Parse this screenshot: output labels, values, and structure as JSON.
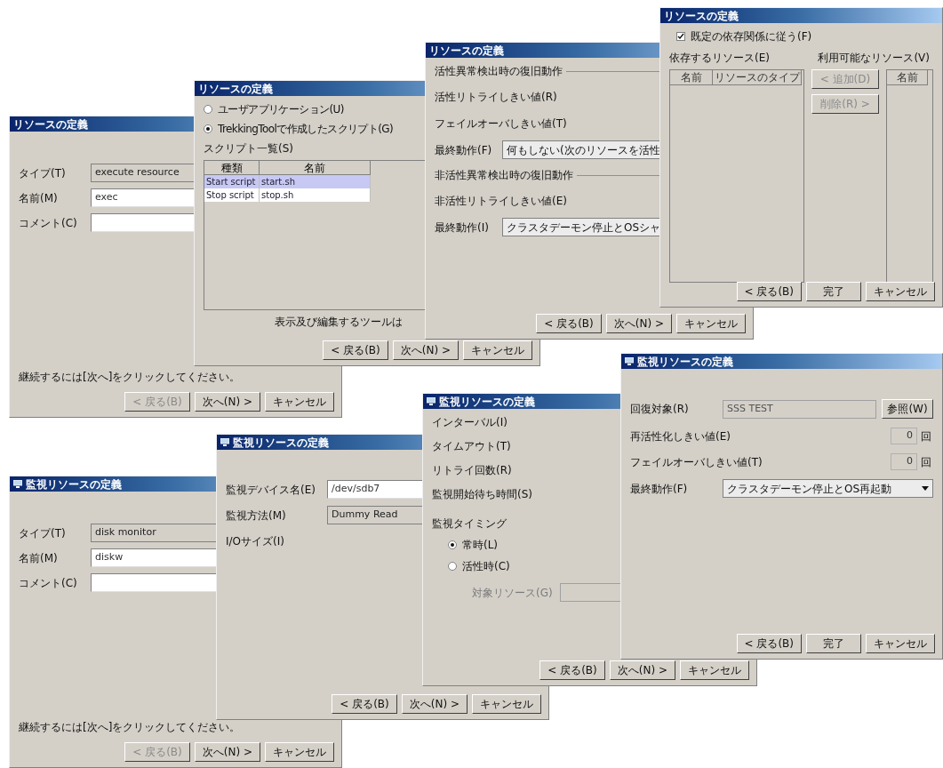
{
  "windows": [
    {
      "title": "リソースの定義",
      "title_icon": false,
      "items": [
        {
          "kind": "field",
          "label": "タイプ(T)",
          "control": {
            "kind": "combo",
            "value": "execute resource"
          }
        },
        {
          "kind": "field",
          "label": "名前(M)",
          "control": {
            "kind": "text",
            "value": "exec"
          }
        },
        {
          "kind": "field",
          "label": "コメント(C)",
          "control": {
            "kind": "text"
          }
        }
      ],
      "note": "継続するには[次へ]をクリックしてください。",
      "buttons": [
        {
          "label": "< 戻る(B)",
          "disabled": true
        },
        {
          "label": "次へ(N) >",
          "disabled": false
        },
        {
          "label": "キャンセル",
          "disabled": false
        }
      ]
    },
    {
      "title": "リソースの定義",
      "title_icon": false,
      "items": [
        {
          "kind": "radio",
          "label": "ユーザアプリケーション(U)",
          "selected": false
        },
        {
          "kind": "radio",
          "label": "TrekkingToolで作成したスクリプト(G)",
          "selected": true
        },
        {
          "kind": "label",
          "label": "スクリプト一覧(S)"
        },
        {
          "kind": "table",
          "columns": [
            "種類",
            "名前"
          ],
          "rows": [
            {
              "cells": [
                "Start script",
                "start.sh"
              ],
              "selected": true
            },
            {
              "cells": [
                "Stop script",
                "stop.sh"
              ],
              "selected": false
            }
          ]
        },
        {
          "kind": "caption",
          "label": "表示及び編集するツールは"
        }
      ],
      "buttons": [
        {
          "label": "< 戻る(B)",
          "disabled": false
        },
        {
          "label": "次へ(N) >",
          "disabled": false
        },
        {
          "label": "キャンセル",
          "disabled": false
        }
      ]
    },
    {
      "title": "リソースの定義",
      "title_icon": false,
      "items": [
        {
          "kind": "heading",
          "label": "活性異常検出時の復旧動作"
        },
        {
          "kind": "field",
          "label": "活性リトライしきい値(R)"
        },
        {
          "kind": "field",
          "label": "フェイルオーバしきい値(T)"
        },
        {
          "kind": "field",
          "label": "最終動作(F)",
          "control": {
            "kind": "select",
            "value": "何もしない(次のリソースを活性"
          }
        },
        {
          "kind": "heading",
          "label": "非活性異常検出時の復旧動作"
        },
        {
          "kind": "field",
          "label": "非活性リトライしきい値(E)"
        },
        {
          "kind": "field",
          "label": "最終動作(I)",
          "control": {
            "kind": "select",
            "value": "クラスタデーモン停止とOSシャ"
          }
        }
      ],
      "buttons": [
        {
          "label": "< 戻る(B)",
          "disabled": false
        },
        {
          "label": "次へ(N) >",
          "disabled": false
        },
        {
          "label": "キャンセル",
          "disabled": false
        }
      ]
    },
    {
      "title": "リソースの定義",
      "title_icon": false,
      "items": [
        {
          "kind": "checkbox",
          "label": "既定の依存関係に従う(F)",
          "checked": true
        },
        {
          "kind": "dual_list",
          "left_label": "依存するリソース(E)",
          "right_label": "利用可能なリソース(V)",
          "left_columns": [
            "名前",
            "リソースのタイプ"
          ],
          "right_columns": [
            "名前"
          ],
          "buttons": [
            {
              "label": "< 追加(D)",
              "disabled": true
            },
            {
              "label": "削除(R) >",
              "disabled": true
            }
          ]
        }
      ],
      "buttons": [
        {
          "label": "< 戻る(B)",
          "disabled": false
        },
        {
          "label": "完了",
          "disabled": false
        },
        {
          "label": "キャンセル",
          "disabled": false
        }
      ]
    },
    {
      "title": "監視リソースの定義",
      "title_icon": true,
      "items": [
        {
          "kind": "field",
          "label": "タイプ(T)",
          "control": {
            "kind": "combo",
            "value": "disk monitor"
          }
        },
        {
          "kind": "field",
          "label": "名前(M)",
          "control": {
            "kind": "text",
            "value": "diskw"
          }
        },
        {
          "kind": "field",
          "label": "コメント(C)",
          "control": {
            "kind": "text"
          }
        }
      ],
      "note": "継続するには[次へ]をクリックしてください。",
      "buttons": [
        {
          "label": "< 戻る(B)",
          "disabled": true
        },
        {
          "label": "次へ(N) >",
          "disabled": false
        },
        {
          "label": "キャンセル",
          "disabled": false
        }
      ]
    },
    {
      "title": "監視リソースの定義",
      "title_icon": true,
      "items": [
        {
          "kind": "field",
          "label": "監視デバイス名(E)",
          "control": {
            "kind": "text",
            "value": "/dev/sdb7"
          }
        },
        {
          "kind": "field",
          "label": "監視方法(M)",
          "control": {
            "kind": "combo",
            "value": "Dummy Read"
          }
        },
        {
          "kind": "field",
          "label": "I/Oサイズ(I)"
        }
      ],
      "buttons": [
        {
          "label": "< 戻る(B)",
          "disabled": false
        },
        {
          "label": "次へ(N) >",
          "disabled": false
        },
        {
          "label": "キャンセル",
          "disabled": false
        }
      ]
    },
    {
      "title": "監視リソースの定義",
      "title_icon": true,
      "items": [
        {
          "kind": "field",
          "label": "インターバル(I)"
        },
        {
          "kind": "field",
          "label": "タイムアウト(T)"
        },
        {
          "kind": "field",
          "label": "リトライ回数(R)"
        },
        {
          "kind": "field",
          "label": "監視開始待ち時間(S)"
        },
        {
          "kind": "radio_group",
          "label": "監視タイミング",
          "options": [
            {
              "label": "常時(L)",
              "selected": true
            },
            {
              "label": "活性時(C)",
              "selected": false
            }
          ],
          "sub_field": {
            "label": "対象リソース(G)",
            "disabled": true
          }
        }
      ],
      "buttons": [
        {
          "label": "< 戻る(B)",
          "disabled": false
        },
        {
          "label": "次へ(N) >",
          "disabled": false
        },
        {
          "label": "キャンセル",
          "disabled": false
        }
      ]
    },
    {
      "title": "監視リソースの定義",
      "title_icon": true,
      "items": [
        {
          "kind": "browse",
          "label": "回復対象(R)",
          "value": "SSS TEST",
          "button": "参照(W)"
        },
        {
          "kind": "spin",
          "label": "再活性化しきい値(E)",
          "value": "0",
          "unit": "回"
        },
        {
          "kind": "spin",
          "label": "フェイルオーバしきい値(T)",
          "value": "0",
          "unit": "回"
        },
        {
          "kind": "field",
          "label": "最終動作(F)",
          "control": {
            "kind": "dropdown",
            "value": "クラスタデーモン停止とOS再起動"
          }
        }
      ],
      "buttons": [
        {
          "label": "< 戻る(B)",
          "disabled": false
        },
        {
          "label": "完了",
          "disabled": false
        },
        {
          "label": "キャンセル",
          "disabled": false
        }
      ]
    }
  ]
}
